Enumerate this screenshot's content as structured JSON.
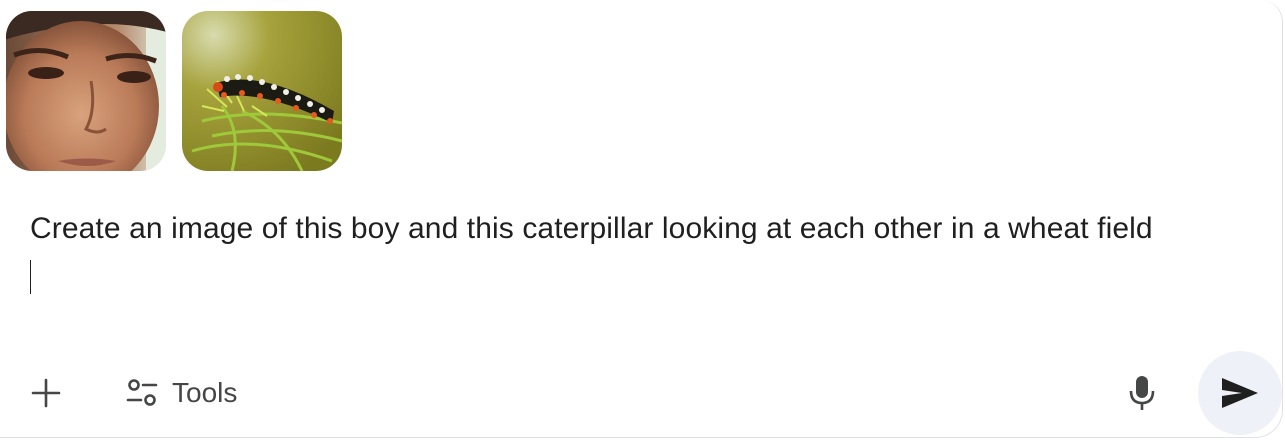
{
  "attachments": [
    {
      "kind": "image",
      "subject": "boy"
    },
    {
      "kind": "image",
      "subject": "caterpillar"
    }
  ],
  "prompt": {
    "text": "Create an image of this boy and this caterpillar looking at each other in a wheat field"
  },
  "toolbar": {
    "add_icon": "plus-icon",
    "tools_icon": "tools-sliders-icon",
    "tools_label": "Tools",
    "mic_icon": "microphone-icon",
    "send_icon": "send-icon"
  },
  "colors": {
    "text": "#1f1f1f",
    "icon": "#444746",
    "send_bg": "#eef1f8"
  }
}
